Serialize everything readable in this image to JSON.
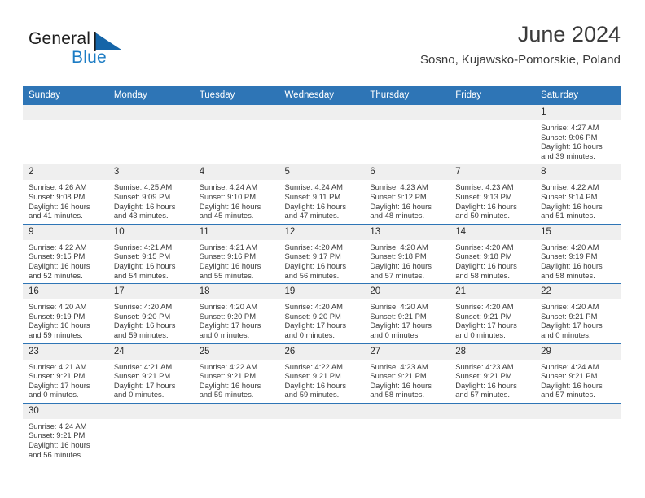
{
  "brand": {
    "name_part1": "General",
    "name_part2": "Blue",
    "flag_icon": "blue-triangle-flag-icon",
    "colors": {
      "dark": "#1d1d1d",
      "blue": "#1c7cc4"
    }
  },
  "header": {
    "title": "June 2024",
    "subtitle": "Sosno, Kujawsko-Pomorskie, Poland"
  },
  "theme": {
    "header_bar": "#2e75b6",
    "row_divider": "#2e75b6",
    "daynum_band": "#efefef",
    "page_background": "#ffffff",
    "text": "#3b3b3b"
  },
  "weekday_headers": [
    "Sunday",
    "Monday",
    "Tuesday",
    "Wednesday",
    "Thursday",
    "Friday",
    "Saturday"
  ],
  "labels": {
    "sunrise": "Sunrise:",
    "sunset": "Sunset:",
    "daylight": "Daylight:"
  },
  "weeks": [
    [
      {
        "day": "",
        "empty": true
      },
      {
        "day": "",
        "empty": true
      },
      {
        "day": "",
        "empty": true
      },
      {
        "day": "",
        "empty": true
      },
      {
        "day": "",
        "empty": true
      },
      {
        "day": "",
        "empty": true
      },
      {
        "day": "1",
        "sunrise": "Sunrise: 4:27 AM",
        "sunset": "Sunset: 9:06 PM",
        "daylight": "Daylight: 16 hours and 39 minutes."
      }
    ],
    [
      {
        "day": "2",
        "sunrise": "Sunrise: 4:26 AM",
        "sunset": "Sunset: 9:08 PM",
        "daylight": "Daylight: 16 hours and 41 minutes."
      },
      {
        "day": "3",
        "sunrise": "Sunrise: 4:25 AM",
        "sunset": "Sunset: 9:09 PM",
        "daylight": "Daylight: 16 hours and 43 minutes."
      },
      {
        "day": "4",
        "sunrise": "Sunrise: 4:24 AM",
        "sunset": "Sunset: 9:10 PM",
        "daylight": "Daylight: 16 hours and 45 minutes."
      },
      {
        "day": "5",
        "sunrise": "Sunrise: 4:24 AM",
        "sunset": "Sunset: 9:11 PM",
        "daylight": "Daylight: 16 hours and 47 minutes."
      },
      {
        "day": "6",
        "sunrise": "Sunrise: 4:23 AM",
        "sunset": "Sunset: 9:12 PM",
        "daylight": "Daylight: 16 hours and 48 minutes."
      },
      {
        "day": "7",
        "sunrise": "Sunrise: 4:23 AM",
        "sunset": "Sunset: 9:13 PM",
        "daylight": "Daylight: 16 hours and 50 minutes."
      },
      {
        "day": "8",
        "sunrise": "Sunrise: 4:22 AM",
        "sunset": "Sunset: 9:14 PM",
        "daylight": "Daylight: 16 hours and 51 minutes."
      }
    ],
    [
      {
        "day": "9",
        "sunrise": "Sunrise: 4:22 AM",
        "sunset": "Sunset: 9:15 PM",
        "daylight": "Daylight: 16 hours and 52 minutes."
      },
      {
        "day": "10",
        "sunrise": "Sunrise: 4:21 AM",
        "sunset": "Sunset: 9:15 PM",
        "daylight": "Daylight: 16 hours and 54 minutes."
      },
      {
        "day": "11",
        "sunrise": "Sunrise: 4:21 AM",
        "sunset": "Sunset: 9:16 PM",
        "daylight": "Daylight: 16 hours and 55 minutes."
      },
      {
        "day": "12",
        "sunrise": "Sunrise: 4:20 AM",
        "sunset": "Sunset: 9:17 PM",
        "daylight": "Daylight: 16 hours and 56 minutes."
      },
      {
        "day": "13",
        "sunrise": "Sunrise: 4:20 AM",
        "sunset": "Sunset: 9:18 PM",
        "daylight": "Daylight: 16 hours and 57 minutes."
      },
      {
        "day": "14",
        "sunrise": "Sunrise: 4:20 AM",
        "sunset": "Sunset: 9:18 PM",
        "daylight": "Daylight: 16 hours and 58 minutes."
      },
      {
        "day": "15",
        "sunrise": "Sunrise: 4:20 AM",
        "sunset": "Sunset: 9:19 PM",
        "daylight": "Daylight: 16 hours and 58 minutes."
      }
    ],
    [
      {
        "day": "16",
        "sunrise": "Sunrise: 4:20 AM",
        "sunset": "Sunset: 9:19 PM",
        "daylight": "Daylight: 16 hours and 59 minutes."
      },
      {
        "day": "17",
        "sunrise": "Sunrise: 4:20 AM",
        "sunset": "Sunset: 9:20 PM",
        "daylight": "Daylight: 16 hours and 59 minutes."
      },
      {
        "day": "18",
        "sunrise": "Sunrise: 4:20 AM",
        "sunset": "Sunset: 9:20 PM",
        "daylight": "Daylight: 17 hours and 0 minutes."
      },
      {
        "day": "19",
        "sunrise": "Sunrise: 4:20 AM",
        "sunset": "Sunset: 9:20 PM",
        "daylight": "Daylight: 17 hours and 0 minutes."
      },
      {
        "day": "20",
        "sunrise": "Sunrise: 4:20 AM",
        "sunset": "Sunset: 9:21 PM",
        "daylight": "Daylight: 17 hours and 0 minutes."
      },
      {
        "day": "21",
        "sunrise": "Sunrise: 4:20 AM",
        "sunset": "Sunset: 9:21 PM",
        "daylight": "Daylight: 17 hours and 0 minutes."
      },
      {
        "day": "22",
        "sunrise": "Sunrise: 4:20 AM",
        "sunset": "Sunset: 9:21 PM",
        "daylight": "Daylight: 17 hours and 0 minutes."
      }
    ],
    [
      {
        "day": "23",
        "sunrise": "Sunrise: 4:21 AM",
        "sunset": "Sunset: 9:21 PM",
        "daylight": "Daylight: 17 hours and 0 minutes."
      },
      {
        "day": "24",
        "sunrise": "Sunrise: 4:21 AM",
        "sunset": "Sunset: 9:21 PM",
        "daylight": "Daylight: 17 hours and 0 minutes."
      },
      {
        "day": "25",
        "sunrise": "Sunrise: 4:22 AM",
        "sunset": "Sunset: 9:21 PM",
        "daylight": "Daylight: 16 hours and 59 minutes."
      },
      {
        "day": "26",
        "sunrise": "Sunrise: 4:22 AM",
        "sunset": "Sunset: 9:21 PM",
        "daylight": "Daylight: 16 hours and 59 minutes."
      },
      {
        "day": "27",
        "sunrise": "Sunrise: 4:23 AM",
        "sunset": "Sunset: 9:21 PM",
        "daylight": "Daylight: 16 hours and 58 minutes."
      },
      {
        "day": "28",
        "sunrise": "Sunrise: 4:23 AM",
        "sunset": "Sunset: 9:21 PM",
        "daylight": "Daylight: 16 hours and 57 minutes."
      },
      {
        "day": "29",
        "sunrise": "Sunrise: 4:24 AM",
        "sunset": "Sunset: 9:21 PM",
        "daylight": "Daylight: 16 hours and 57 minutes."
      }
    ],
    [
      {
        "day": "30",
        "sunrise": "Sunrise: 4:24 AM",
        "sunset": "Sunset: 9:21 PM",
        "daylight": "Daylight: 16 hours and 56 minutes."
      },
      {
        "day": "",
        "empty": true
      },
      {
        "day": "",
        "empty": true
      },
      {
        "day": "",
        "empty": true
      },
      {
        "day": "",
        "empty": true
      },
      {
        "day": "",
        "empty": true
      },
      {
        "day": "",
        "empty": true
      }
    ]
  ]
}
